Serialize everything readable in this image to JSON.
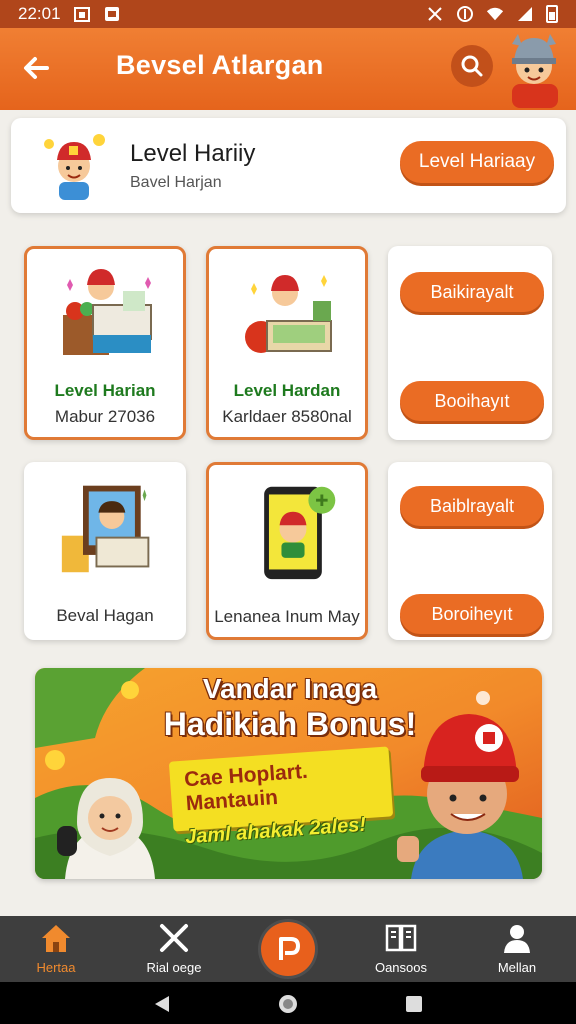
{
  "status_bar": {
    "time": "22:01"
  },
  "app_bar": {
    "title": "Bevsel Atlargan"
  },
  "header_card": {
    "title": "Level Hariiy",
    "subtitle": "Bavel Harjan",
    "button_label": "Level Hariaay"
  },
  "tiles": [
    {
      "title": "Level Harian",
      "subtitle": "Mabur 27036"
    },
    {
      "title": "Level Hardan",
      "subtitle": "Karldaer 8580nal"
    },
    {
      "caption": "Beval Hagan"
    },
    {
      "caption": "Lenanea Inum May"
    }
  ],
  "side_buttons": [
    {
      "label": "Baikirayalt"
    },
    {
      "label": "Booihayıt"
    },
    {
      "label": "Baiblrayalt"
    },
    {
      "label": "Boroiheyıt"
    }
  ],
  "banner": {
    "line1": "Vandar Inaga",
    "line2": "Hadikiah Bonus!",
    "plate_line1": "Cae Hoplart.",
    "plate_line2": "Mantauin",
    "footer": "Jaml ahakak 2ales!"
  },
  "bottom_nav": [
    {
      "label": "Hertaa",
      "icon": "home-icon",
      "active": true
    },
    {
      "label": "Rial oege",
      "icon": "crossed-tools-icon"
    },
    {
      "label": "",
      "icon": "p-badge-icon"
    },
    {
      "label": "Oansoos",
      "icon": "book-icon"
    },
    {
      "label": "Mellan",
      "icon": "person-icon"
    }
  ],
  "colors": {
    "brand_orange": "#e8651d",
    "status_bar": "#b0461b",
    "tile_title_green": "#1e7a1e",
    "nav_bg": "#3e3e3e"
  }
}
